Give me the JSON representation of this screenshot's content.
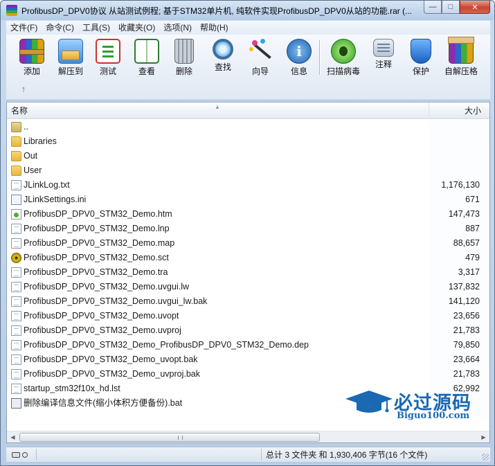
{
  "window": {
    "title": "ProfibusDP_DPV0协议 从站测试例程; 基于STM32单片机, 纯软件实现ProfibusDP_DPV0从站的功能.rar (...",
    "controls": {
      "minimize": "—",
      "maximize": "□",
      "close": "✕"
    }
  },
  "menubar": {
    "items": [
      "文件(F)",
      "命令(C)",
      "工具(S)",
      "收藏夹(O)",
      "选项(N)",
      "帮助(H)"
    ]
  },
  "toolbar": {
    "tools": [
      {
        "label": "添加",
        "icon": "add-archive-icon"
      },
      {
        "label": "解压到",
        "icon": "extract-to-icon"
      },
      {
        "label": "测试",
        "icon": "test-archive-icon"
      },
      {
        "label": "查看",
        "icon": "view-book-icon"
      },
      {
        "label": "删除",
        "icon": "trash-can-icon"
      },
      {
        "label": "查找",
        "icon": "magnifier-icon"
      },
      {
        "label": "向导",
        "icon": "wizard-wand-icon"
      },
      {
        "label": "信息",
        "icon": "info-icon"
      },
      {
        "label": "扫描病毒",
        "icon": "virus-scan-icon"
      },
      {
        "label": "注释",
        "icon": "comment-icon"
      },
      {
        "label": "保护",
        "icon": "shield-icon"
      },
      {
        "label": "自解压格",
        "icon": "sfx-box-icon"
      }
    ],
    "up_arrow": "↑"
  },
  "filelist": {
    "columns": {
      "name": "名称",
      "size": "大小"
    },
    "sort_indicator": "▲",
    "rows": [
      {
        "name": "..",
        "size": "",
        "type": "parent"
      },
      {
        "name": "Libraries",
        "size": "",
        "type": "folder"
      },
      {
        "name": "Out",
        "size": "",
        "type": "folder"
      },
      {
        "name": "User",
        "size": "",
        "type": "folder"
      },
      {
        "name": "JLinkLog.txt",
        "size": "1,176,130",
        "type": "doc"
      },
      {
        "name": "JLinkSettings.ini",
        "size": "671",
        "type": "ini"
      },
      {
        "name": "ProfibusDP_DPV0_STM32_Demo.htm",
        "size": "147,473",
        "type": "htm"
      },
      {
        "name": "ProfibusDP_DPV0_STM32_Demo.lnp",
        "size": "887",
        "type": "doc"
      },
      {
        "name": "ProfibusDP_DPV0_STM32_Demo.map",
        "size": "88,657",
        "type": "doc"
      },
      {
        "name": "ProfibusDP_DPV0_STM32_Demo.sct",
        "size": "479",
        "type": "gear"
      },
      {
        "name": "ProfibusDP_DPV0_STM32_Demo.tra",
        "size": "3,317",
        "type": "doc"
      },
      {
        "name": "ProfibusDP_DPV0_STM32_Demo.uvgui.lw",
        "size": "137,832",
        "type": "doc"
      },
      {
        "name": "ProfibusDP_DPV0_STM32_Demo.uvgui_lw.bak",
        "size": "141,120",
        "type": "doc"
      },
      {
        "name": "ProfibusDP_DPV0_STM32_Demo.uvopt",
        "size": "23,656",
        "type": "doc"
      },
      {
        "name": "ProfibusDP_DPV0_STM32_Demo.uvproj",
        "size": "21,783",
        "type": "doc"
      },
      {
        "name": "ProfibusDP_DPV0_STM32_Demo_ProfibusDP_DPV0_STM32_Demo.dep",
        "size": "79,850",
        "type": "doc"
      },
      {
        "name": "ProfibusDP_DPV0_STM32_Demo_uvopt.bak",
        "size": "23,664",
        "type": "doc"
      },
      {
        "name": "ProfibusDP_DPV0_STM32_Demo_uvproj.bak",
        "size": "21,783",
        "type": "doc"
      },
      {
        "name": "startup_stm32f10x_hd.lst",
        "size": "62,992",
        "type": "doc"
      },
      {
        "name": "删除编译信息文件(缩小体积方便备份).bat",
        "size": "",
        "type": "bat"
      }
    ],
    "scroll": {
      "left": "◀",
      "right": "▶"
    }
  },
  "watermark": {
    "cn": "必过源码",
    "en": "Biguo100.com",
    "color": "#1b68b3"
  },
  "statusbar": {
    "summary": "总计 3 文件夹 和 1,930,406 字节(16 个文件)"
  }
}
